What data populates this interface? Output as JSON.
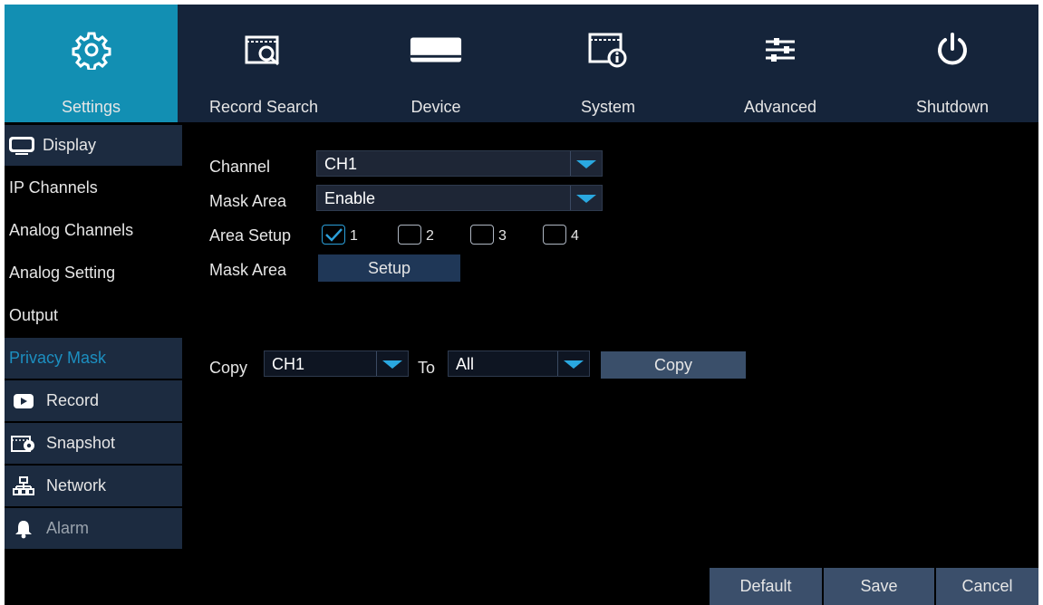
{
  "nav": {
    "items": [
      {
        "label": "Settings",
        "icon": "gear-icon"
      },
      {
        "label": "Record Search",
        "icon": "record-search-icon"
      },
      {
        "label": "Device",
        "icon": "hard-drive-icon"
      },
      {
        "label": "System",
        "icon": "system-info-icon"
      },
      {
        "label": "Advanced",
        "icon": "sliders-icon"
      },
      {
        "label": "Shutdown",
        "icon": "power-icon"
      }
    ],
    "active": "Settings"
  },
  "sidebar": {
    "display": "Display",
    "ip_channels": "IP Channels",
    "analog_channels": "Analog Channels",
    "analog_setting": "Analog Setting",
    "output": "Output",
    "privacy_mask": "Privacy Mask",
    "record": "Record",
    "snapshot": "Snapshot",
    "network": "Network",
    "alarm": "Alarm"
  },
  "form": {
    "channel_label": "Channel",
    "channel_value": "CH1",
    "mask_area_label": "Mask Area",
    "mask_area_value": "Enable",
    "area_setup_label": "Area Setup",
    "areas": [
      {
        "label": "1",
        "checked": true
      },
      {
        "label": "2",
        "checked": false
      },
      {
        "label": "3",
        "checked": false
      },
      {
        "label": "4",
        "checked": false
      }
    ],
    "mask_area_setup_label": "Mask Area",
    "setup_button": "Setup",
    "copy_label": "Copy",
    "copy_from_value": "CH1",
    "to_label": "To",
    "copy_to_value": "All",
    "copy_button": "Copy"
  },
  "footer": {
    "default": "Default",
    "save": "Save",
    "cancel": "Cancel"
  },
  "colors": {
    "accent": "#128fb3",
    "nav_bg": "#15243a",
    "sidebar_category_bg": "#1c2b40",
    "active_sub_text": "#1c8fc0",
    "button_bg": "#1f3757"
  }
}
